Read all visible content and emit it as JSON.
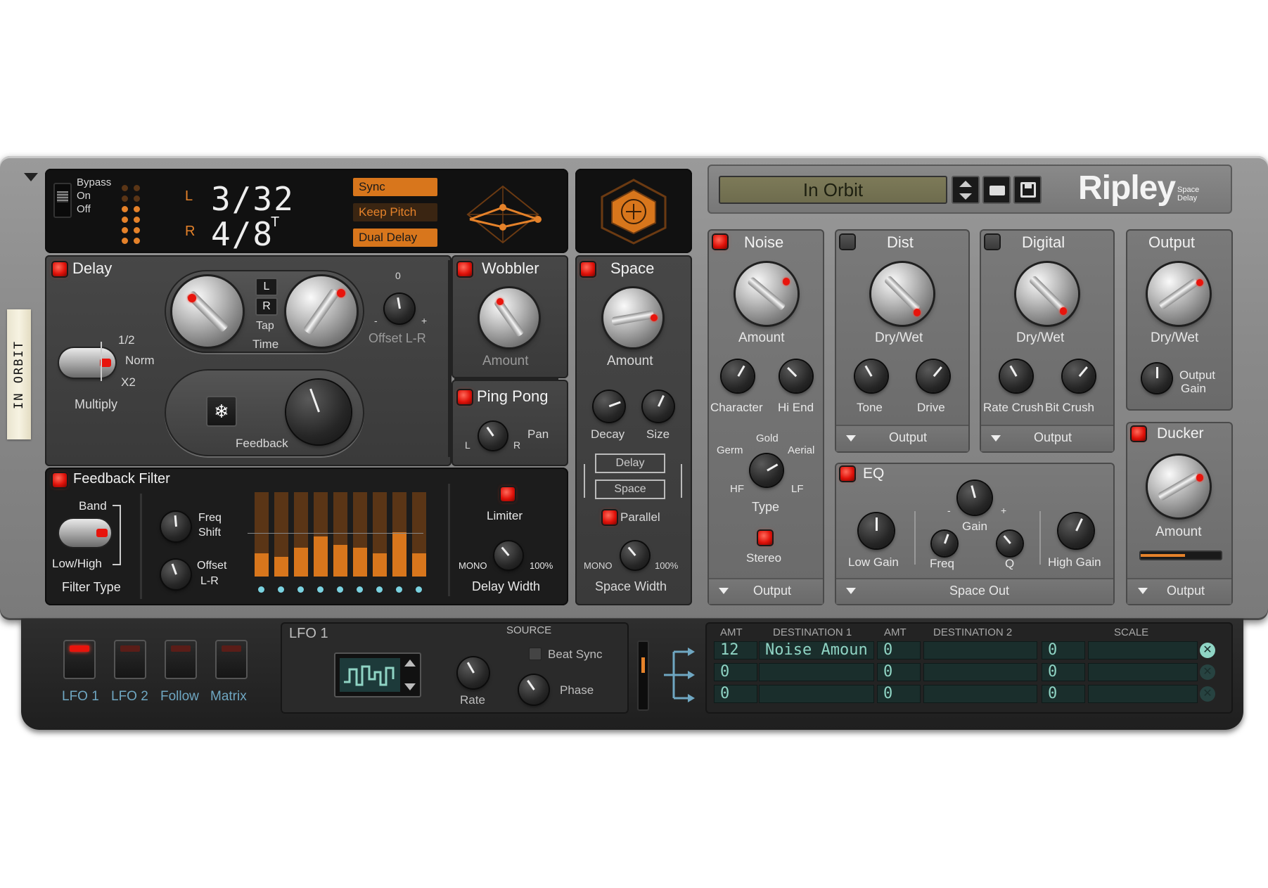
{
  "device": {
    "brand": "Ripley",
    "brand_sub_1": "Space",
    "brand_sub_2": "Delay",
    "tape_label": "IN ORBIT"
  },
  "bypass": {
    "bypass": "Bypass",
    "on": "On",
    "off": "Off"
  },
  "delay_display": {
    "l_label": "L",
    "r_label": "R",
    "l_value": "3/32",
    "r_value": "4/8",
    "r_suffix": "T",
    "sync": "Sync",
    "keep_pitch": "Keep Pitch",
    "dual_delay": "Dual Delay"
  },
  "preset": {
    "name": "In Orbit"
  },
  "delay": {
    "title": "Delay",
    "multiply_options": [
      "1/2",
      "Norm",
      "X2"
    ],
    "multiply_label": "Multiply",
    "tap": "Tap",
    "time": "Time",
    "l_btn": "L",
    "r_btn": "R",
    "offset_zero": "0",
    "offset_minus": "-",
    "offset_plus": "+",
    "offset_label": "Offset L-R",
    "feedback": "Feedback"
  },
  "wobbler": {
    "title": "Wobbler",
    "amount": "Amount"
  },
  "ping_pong": {
    "title": "Ping Pong",
    "pan": "Pan",
    "l": "L",
    "r": "R"
  },
  "space": {
    "title": "Space",
    "amount": "Amount",
    "decay": "Decay",
    "size": "Size",
    "route_delay": "Delay",
    "route_space": "Space",
    "parallel": "Parallel",
    "mono": "MONO",
    "pct": "100%",
    "width": "Space Width"
  },
  "feedback_filter": {
    "title": "Feedback Filter",
    "band": "Band",
    "low_high": "Low/High",
    "filter_type": "Filter Type",
    "freq": "Freq",
    "shift": "Shift",
    "offset": "Offset",
    "lr": "L-R",
    "bars": [
      0.45,
      0.38,
      0.55,
      0.77,
      0.6,
      0.55,
      0.45,
      0.85,
      0.45
    ],
    "limiter": "Limiter",
    "mono": "MONO",
    "pct": "100%",
    "delay_width": "Delay Width"
  },
  "noise": {
    "title": "Noise",
    "amount": "Amount",
    "character": "Character",
    "hi_end": "Hi End",
    "germ": "Germ",
    "gold": "Gold",
    "aerial": "Aerial",
    "hf": "HF",
    "lf": "LF",
    "type": "Type",
    "stereo": "Stereo",
    "output": "Output"
  },
  "dist": {
    "title": "Dist",
    "dry_wet": "Dry/Wet",
    "tone": "Tone",
    "drive": "Drive",
    "output": "Output"
  },
  "digital": {
    "title": "Digital",
    "dry_wet": "Dry/Wet",
    "rate_crush": "Rate Crush",
    "bit_crush": "Bit Crush",
    "output": "Output"
  },
  "output": {
    "title": "Output",
    "dry_wet": "Dry/Wet",
    "output": "Output",
    "gain": "Gain"
  },
  "eq": {
    "title": "EQ",
    "low_gain": "Low Gain",
    "freq": "Freq",
    "gain": "Gain",
    "minus": "-",
    "plus": "+",
    "q": "Q",
    "high_gain": "High Gain",
    "space_out": "Space Out"
  },
  "ducker": {
    "title": "Ducker",
    "amount": "Amount",
    "output": "Output",
    "level": 0.55
  },
  "mod": {
    "tabs": [
      "LFO 1",
      "LFO 2",
      "Follow",
      "Matrix"
    ],
    "lfo_title": "LFO 1",
    "source": "SOURCE",
    "beat_sync": "Beat Sync",
    "rate": "Rate",
    "phase": "Phase"
  },
  "matrix": {
    "headers": [
      "AMT",
      "DESTINATION 1",
      "AMT",
      "DESTINATION 2",
      "SCALE"
    ],
    "rows": [
      [
        "12",
        "Noise Amoun",
        "0",
        "",
        "0"
      ],
      [
        "0",
        "",
        "0",
        "",
        "0"
      ],
      [
        "0",
        "",
        "0",
        "",
        "0"
      ]
    ]
  },
  "colors": {
    "accent": "#d8761c",
    "led": "#e0120a",
    "lcd": "#8fd4c4"
  }
}
